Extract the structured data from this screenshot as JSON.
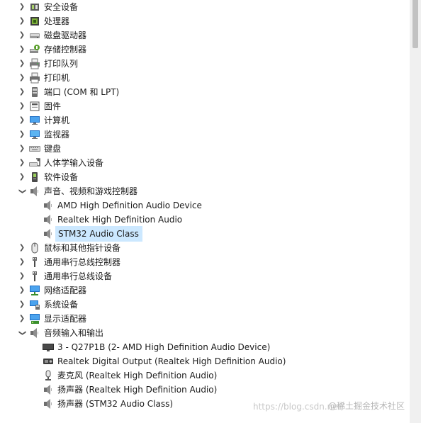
{
  "tree": {
    "top_items": [
      {
        "label": "安全设备",
        "icon": "security-device-icon",
        "expanded": false
      },
      {
        "label": "处理器",
        "icon": "processor-icon",
        "expanded": false
      },
      {
        "label": "磁盘驱动器",
        "icon": "disk-drive-icon",
        "expanded": false
      },
      {
        "label": "存储控制器",
        "icon": "storage-controller-icon",
        "expanded": false
      },
      {
        "label": "打印队列",
        "icon": "print-queue-icon",
        "expanded": false
      },
      {
        "label": "打印机",
        "icon": "printer-icon",
        "expanded": false
      },
      {
        "label": "端口 (COM 和 LPT)",
        "icon": "port-icon",
        "expanded": false
      },
      {
        "label": "固件",
        "icon": "firmware-icon",
        "expanded": false
      },
      {
        "label": "计算机",
        "icon": "computer-icon",
        "expanded": false
      },
      {
        "label": "监视器",
        "icon": "monitor-icon",
        "expanded": false
      },
      {
        "label": "键盘",
        "icon": "keyboard-icon",
        "expanded": false
      },
      {
        "label": "人体学输入设备",
        "icon": "hid-icon",
        "expanded": false
      },
      {
        "label": "软件设备",
        "icon": "software-device-icon",
        "expanded": false
      },
      {
        "label": "声音、视频和游戏控制器",
        "icon": "speaker-icon",
        "expanded": true
      },
      {
        "label": "鼠标和其他指针设备",
        "icon": "mouse-icon",
        "expanded": false
      },
      {
        "label": "通用串行总线控制器",
        "icon": "usb-icon",
        "expanded": false
      },
      {
        "label": "通用串行总线设备",
        "icon": "usb-icon",
        "expanded": false
      },
      {
        "label": "网络适配器",
        "icon": "network-adapter-icon",
        "expanded": false
      },
      {
        "label": "系统设备",
        "icon": "system-device-icon",
        "expanded": false
      },
      {
        "label": "显示适配器",
        "icon": "display-adapter-icon",
        "expanded": false
      },
      {
        "label": "音频输入和输出",
        "icon": "speaker-icon",
        "expanded": true
      }
    ],
    "sound_children": [
      {
        "label": "AMD High Definition Audio Device",
        "icon": "speaker-icon"
      },
      {
        "label": "Realtek High Definition Audio",
        "icon": "speaker-icon"
      },
      {
        "label": "STM32 Audio Class",
        "icon": "speaker-icon",
        "selected": true
      }
    ],
    "audio_children": [
      {
        "label": "3 - Q27P1B (2- AMD High Definition Audio Device)",
        "icon": "monitor-icon"
      },
      {
        "label": "Realtek Digital Output (Realtek High Definition Audio)",
        "icon": "digital-output-icon"
      },
      {
        "label": "麦克风 (Realtek High Definition Audio)",
        "icon": "microphone-icon"
      },
      {
        "label": "扬声器 (Realtek High Definition Audio)",
        "icon": "speaker-icon"
      },
      {
        "label": "扬声器 (STM32 Audio Class)",
        "icon": "speaker-icon"
      }
    ]
  },
  "watermark": {
    "csdn": "https://blog.csdn.net/",
    "juejin": "@稀土掘金技术社区"
  },
  "colors": {
    "selection": "#cce8ff",
    "icon_blue": "#2a7fd4",
    "icon_gray": "#6e6e6e"
  }
}
